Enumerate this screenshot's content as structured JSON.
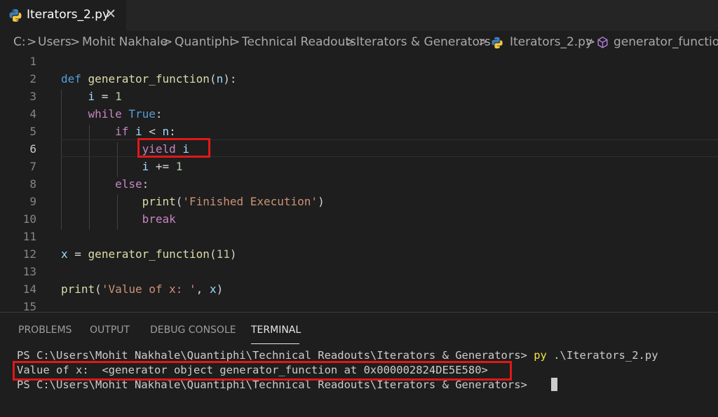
{
  "tab": {
    "title": "Iterators_2.py",
    "close": "✕",
    "icon": "python-icon"
  },
  "breadcrumb": [
    "C:",
    "Users",
    "Mohit Nakhale",
    "Quantiphi",
    "Technical Readouts",
    "Iterators & Generators",
    "Iterators_2.py",
    "generator_function"
  ],
  "breadcrumb_sep": ">",
  "editor": {
    "line_numbers": [
      "1",
      "2",
      "3",
      "4",
      "5",
      "6",
      "7",
      "8",
      "9",
      "10",
      "11",
      "12",
      "13",
      "14",
      "15"
    ],
    "active_line": "6",
    "lines": {
      "l2": {
        "def": "def",
        "name": "generator_function",
        "p1": "(",
        "param": "n",
        "p2": "):"
      },
      "l3": {
        "var": "i",
        "op": " = ",
        "num": "1"
      },
      "l4": {
        "kw": "while",
        "val": "True",
        "colon": ":"
      },
      "l5": {
        "kw": "if",
        "expr1": "i",
        "op": " < ",
        "expr2": "n",
        "colon": ":"
      },
      "l6": {
        "kw": "yield",
        "var": "i"
      },
      "l7": {
        "var": "i",
        "op": " += ",
        "num": "1"
      },
      "l8": {
        "kw": "else",
        "colon": ":"
      },
      "l9": {
        "fn": "print",
        "p1": "(",
        "str": "'Finished Execution'",
        "p2": ")"
      },
      "l10": {
        "kw": "break"
      },
      "l12": {
        "var": "x",
        "op": " = ",
        "fn": "generator_function",
        "p1": "(",
        "num": "11",
        "p2": ")"
      },
      "l14": {
        "fn": "print",
        "p1": "(",
        "str": "'Value of x: '",
        "mid": ", ",
        "var": "x",
        "p2": ")"
      }
    }
  },
  "panel": {
    "tabs": [
      "PROBLEMS",
      "OUTPUT",
      "DEBUG CONSOLE",
      "TERMINAL"
    ],
    "active_tab": "TERMINAL",
    "terminal": {
      "line1_prompt": "PS C:\\Users\\Mohit Nakhale\\Quantiphi\\Technical Readouts\\Iterators & Generators> ",
      "line1_cmd": "py",
      "line1_arg": " .\\Iterators_2.py",
      "line2": "Value of x:  <generator object generator_function at 0x000002824DE5E580>",
      "line3_prompt": "PS C:\\Users\\Mohit Nakhale\\Quantiphi\\Technical Readouts\\Iterators & Generators> "
    }
  },
  "colors": {
    "highlight_box": "#e01818",
    "background": "#1e1e1e"
  }
}
